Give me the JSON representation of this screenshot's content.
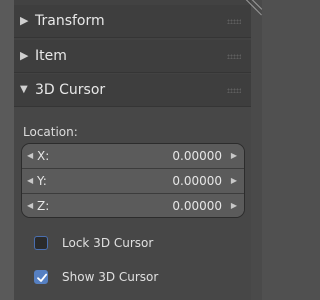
{
  "panels": [
    {
      "label": "Transform",
      "expanded": false,
      "icon": "triangle-right-icon"
    },
    {
      "label": "Item",
      "expanded": false,
      "icon": "triangle-right-icon"
    },
    {
      "label": "3D Cursor",
      "expanded": true,
      "icon": "triangle-down-icon"
    }
  ],
  "cursor": {
    "location_label": "Location:",
    "axes": [
      {
        "axis": "X:",
        "value": "0.00000"
      },
      {
        "axis": "Y:",
        "value": "0.00000"
      },
      {
        "axis": "Z:",
        "value": "0.00000"
      }
    ],
    "lock": {
      "label": "Lock 3D Cursor",
      "checked": false
    },
    "show": {
      "label": "Show 3D Cursor",
      "checked": true
    }
  },
  "colors": {
    "accent": "#5680c2",
    "header_bg": "#3e3e3e",
    "body_bg": "#474747",
    "field_bg": "#5b5b5b"
  }
}
